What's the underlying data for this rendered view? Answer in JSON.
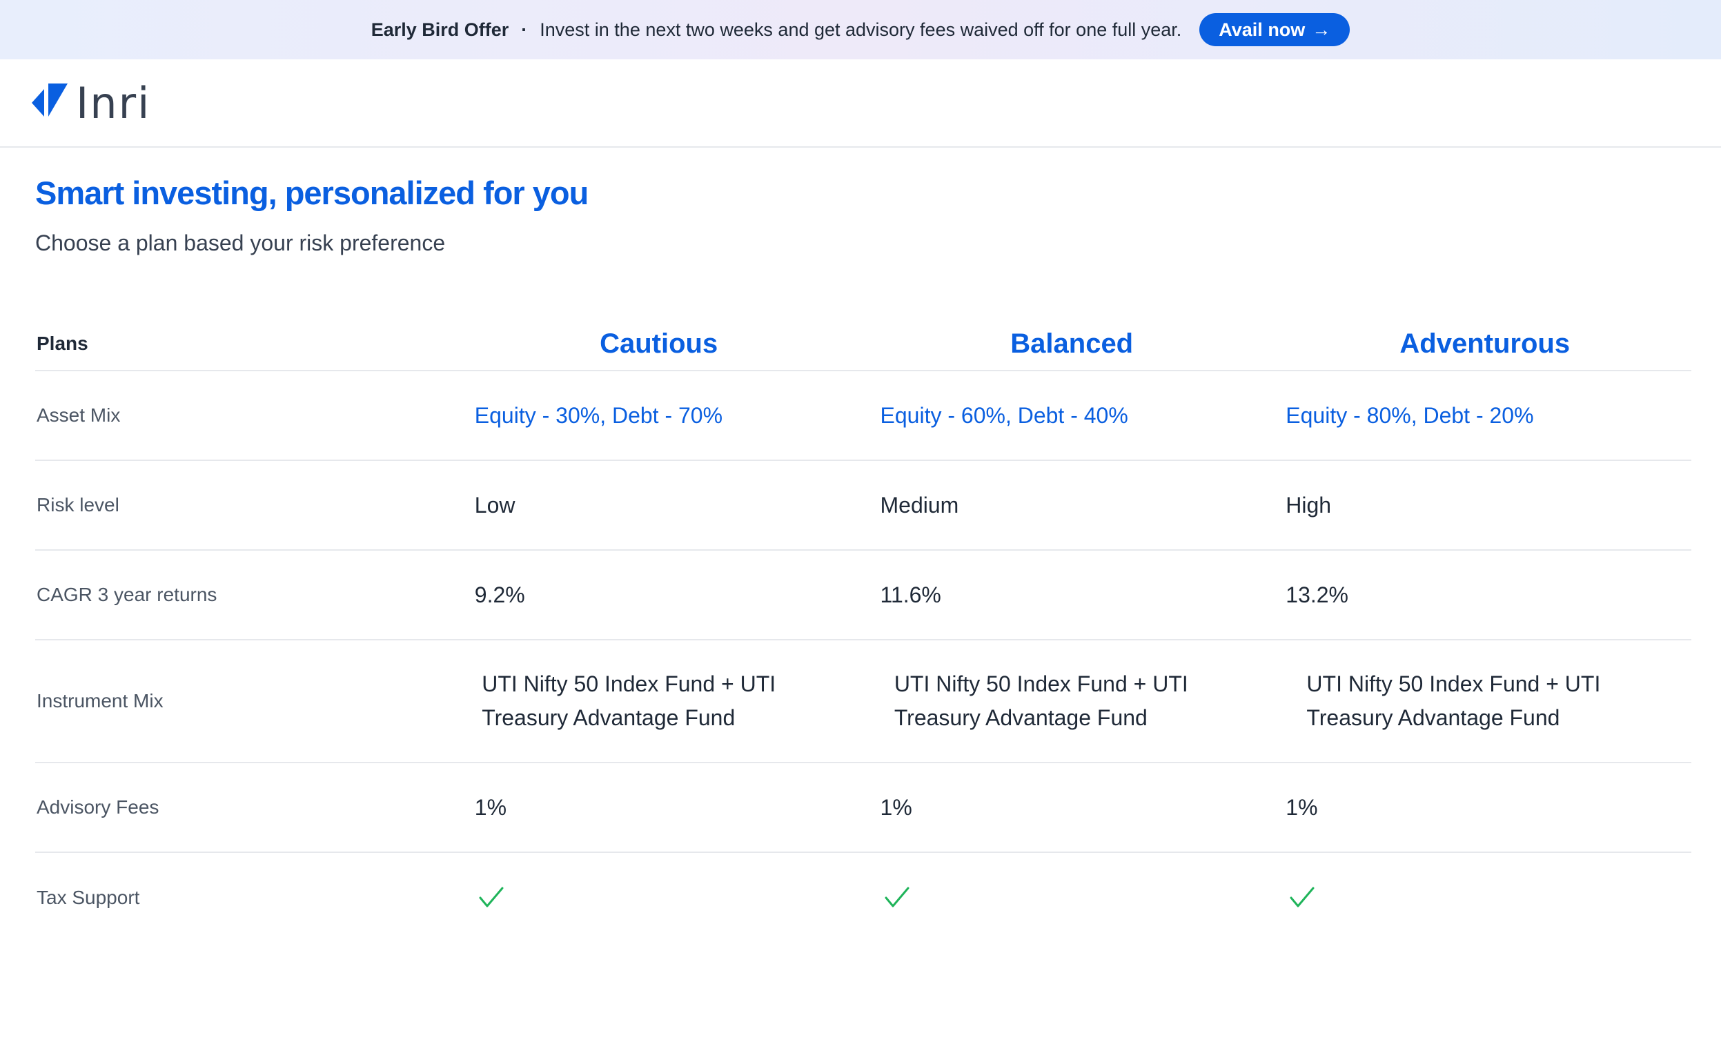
{
  "banner": {
    "title": "Early Bird Offer",
    "separator": "·",
    "message": "Invest in the next two weeks and get advisory fees waived off for one full year.",
    "cta_label": "Avail now",
    "cta_arrow": "→"
  },
  "brand": {
    "name": "Inri",
    "accent_color": "#0a5fe0"
  },
  "hero": {
    "title": "Smart investing, personalized for you",
    "subtitle": "Choose a plan based your risk preference"
  },
  "table": {
    "header_label": "Plans",
    "plans": [
      "Cautious",
      "Balanced",
      "Adventurous"
    ],
    "rows": [
      {
        "label": "Asset Mix",
        "values": [
          "Equity - 30%, Debt - 70%",
          "Equity - 60%, Debt - 40%",
          "Equity - 80%, Debt - 20%"
        ]
      },
      {
        "label": "Risk level",
        "values": [
          "Low",
          "Medium",
          "High"
        ]
      },
      {
        "label": "CAGR 3 year returns",
        "values": [
          "9.2%",
          "11.6%",
          "13.2%"
        ]
      },
      {
        "label": "Instrument Mix",
        "values": [
          "UTI Nifty 50 Index Fund + UTI Treasury Advantage Fund",
          "UTI Nifty 50 Index Fund + UTI Treasury Advantage Fund",
          "UTI Nifty 50 Index Fund + UTI Treasury Advantage Fund"
        ]
      },
      {
        "label": "Advisory Fees",
        "values": [
          "1%",
          "1%",
          "1%"
        ]
      },
      {
        "label": "Tax Support",
        "values": [
          "check-icon",
          "check-icon",
          "check-icon"
        ]
      }
    ],
    "check_color": "#1fb45a"
  }
}
